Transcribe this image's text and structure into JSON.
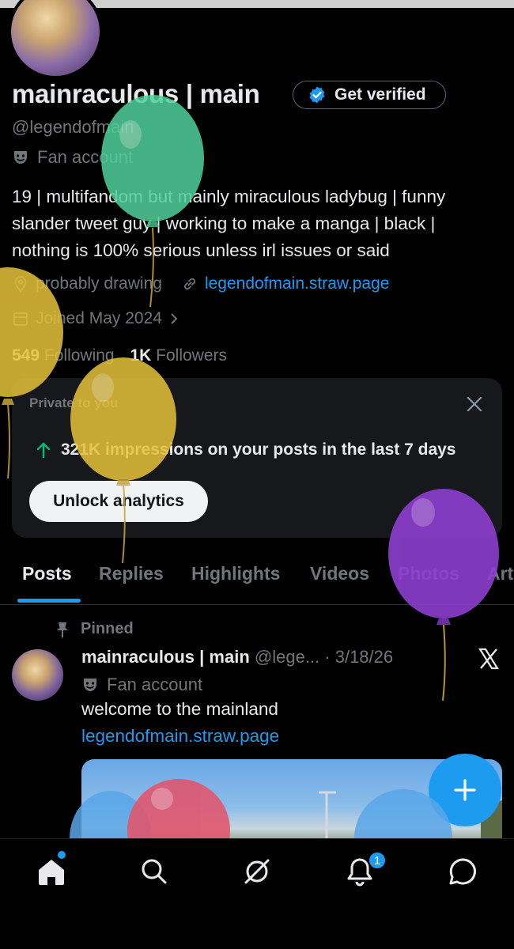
{
  "profile": {
    "name": "mainraculous | main",
    "verify_label": "Get verified",
    "handle": "@legendofmain",
    "account_label": "Fan account",
    "bio": "19 | multifandom but mainly miraculous ladybug | funny\nslander tweet guy | working to make a manga | black |\nnothing is 100% serious unless irl issues or said",
    "location": "probably drawing",
    "website": "legendofmain.straw.page",
    "joined": "Joined May 2024",
    "following_count": "549",
    "following_label": "Following",
    "followers_count": "1K",
    "followers_label": "Followers"
  },
  "analytics_card": {
    "label": "Private to you",
    "impressions_text": "321K impressions on your posts in the last 7 days",
    "button_label": "Unlock analytics"
  },
  "tabs": [
    "Posts",
    "Replies",
    "Highlights",
    "Videos",
    "Photos",
    "Art"
  ],
  "pinned_post": {
    "pinned_label": "Pinned",
    "author": "mainraculous | main",
    "meta": "@lege... · 3/18/26",
    "account_label": "Fan account",
    "text": "welcome to the mainland",
    "link": "legendofmain.straw.page"
  },
  "bottom_nav": {
    "notification_count": "1"
  },
  "colors": {
    "accent": "#1d9bf0",
    "background": "#000000",
    "balloon_green": "#4fd19a",
    "balloon_yellow": "#e6c23a",
    "balloon_purple": "#8e3fd0",
    "balloon_pink": "#e0566f",
    "balloon_blue": "#59a6e8"
  }
}
